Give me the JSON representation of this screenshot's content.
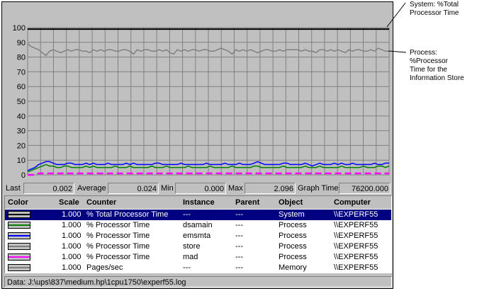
{
  "chart_data": {
    "type": "line",
    "y_ticks": [
      "100",
      "90",
      "80",
      "70",
      "60",
      "50",
      "40",
      "30",
      "20",
      "10",
      "0"
    ],
    "ylim": [
      0,
      100
    ],
    "grid": true,
    "series": [
      {
        "name": "% Total Processor Time",
        "color": "#000000",
        "values": [
          99,
          99,
          99,
          99,
          99,
          99,
          99,
          99,
          99,
          99,
          99,
          99,
          99,
          99,
          99,
          99,
          99,
          99,
          99,
          99,
          99,
          99,
          99,
          99,
          99,
          99,
          99,
          99,
          99,
          99,
          99,
          99,
          99,
          99,
          99,
          99,
          99,
          99,
          99,
          99,
          99,
          99,
          99,
          99,
          99,
          99,
          99,
          99,
          99,
          99,
          99,
          99,
          99,
          99,
          99,
          99,
          99,
          99,
          99,
          99,
          99,
          99,
          99,
          99,
          99,
          99,
          99,
          99,
          99,
          99,
          99,
          99,
          99,
          99,
          99,
          99,
          99,
          99,
          99,
          99,
          99,
          99,
          99,
          99,
          99,
          99,
          99,
          99,
          99,
          99,
          99,
          99,
          99,
          99,
          99,
          99,
          99,
          99,
          99,
          99
        ]
      },
      {
        "name": "% Processor Time (store)",
        "color": "#808080",
        "values": [
          89,
          87,
          86,
          85,
          83,
          81,
          84,
          85,
          84,
          83,
          84,
          85,
          84,
          85,
          85,
          84,
          84,
          83,
          85,
          84,
          85,
          84,
          85,
          85,
          84,
          84,
          85,
          85,
          84,
          82,
          85,
          84,
          85,
          85,
          84,
          84,
          85,
          84,
          85,
          83,
          82,
          85,
          84,
          85,
          84,
          85,
          85,
          84,
          85,
          85,
          84,
          84,
          85,
          86,
          85,
          84,
          82,
          85,
          84,
          85,
          84,
          85,
          84,
          83,
          84,
          85,
          85,
          84,
          84,
          85,
          84,
          85,
          85,
          85,
          85,
          84,
          85,
          84,
          84,
          83,
          85,
          85,
          84,
          85,
          84,
          85,
          84,
          83,
          85,
          84,
          85,
          85,
          84,
          84,
          85,
          84,
          86,
          85,
          84,
          84
        ]
      },
      {
        "name": "% Processor Time (emsmta)",
        "color": "#0000ff",
        "values": [
          3,
          4,
          5,
          7,
          8,
          9,
          9,
          8,
          7,
          7,
          7,
          8,
          8,
          7,
          7,
          7,
          8,
          7,
          8,
          7,
          7,
          7,
          8,
          7,
          7,
          7,
          7,
          8,
          7,
          8,
          7,
          7,
          7,
          7,
          7,
          8,
          8,
          7,
          7,
          7,
          7,
          7,
          8,
          7,
          7,
          7,
          7,
          7,
          7,
          8,
          7,
          7,
          7,
          7,
          8,
          7,
          7,
          7,
          8,
          7,
          7,
          7,
          8,
          9,
          8,
          7,
          7,
          7,
          7,
          7,
          8,
          8,
          7,
          7,
          7,
          7,
          8,
          7,
          6,
          7,
          8,
          7,
          7,
          7,
          8,
          7,
          8,
          7,
          7,
          8,
          7,
          7,
          7,
          7,
          7,
          8,
          7,
          7,
          8,
          8
        ]
      },
      {
        "name": "% Processor Time (dsamain)",
        "color": "#008000",
        "values": [
          2,
          3,
          4,
          5,
          6,
          7,
          6,
          6,
          5,
          5,
          6,
          6,
          5,
          5,
          5,
          5,
          6,
          5,
          6,
          5,
          5,
          5,
          5,
          5,
          6,
          5,
          5,
          5,
          6,
          5,
          5,
          5,
          5,
          5,
          6,
          5,
          5,
          5,
          6,
          5,
          5,
          5,
          5,
          5,
          6,
          5,
          5,
          5,
          5,
          5,
          6,
          5,
          5,
          5,
          5,
          5,
          6,
          5,
          5,
          5,
          5,
          5,
          6,
          6,
          5,
          5,
          5,
          5,
          5,
          5,
          6,
          5,
          5,
          5,
          5,
          5,
          6,
          5,
          5,
          5,
          6,
          5,
          5,
          5,
          5,
          5,
          6,
          5,
          5,
          5,
          5,
          5,
          6,
          5,
          5,
          5,
          6,
          6,
          5,
          6
        ]
      },
      {
        "name": "% Processor Time (mad)",
        "color": "#ff00ff",
        "values": [
          0,
          0,
          0,
          1,
          1,
          1,
          1,
          1,
          1,
          1,
          1,
          1,
          1,
          1,
          1,
          1,
          1,
          1,
          1,
          1,
          1,
          1,
          1,
          1,
          1,
          1,
          1,
          1,
          1,
          1,
          1,
          1,
          1,
          1,
          1,
          1,
          1,
          1,
          1,
          1,
          1,
          1,
          1,
          1,
          1,
          1,
          1,
          1,
          1,
          1,
          1,
          1,
          1,
          1,
          1,
          1,
          1,
          1,
          1,
          1,
          1,
          1,
          1,
          1,
          1,
          1,
          1,
          1,
          1,
          1,
          1,
          1,
          1,
          1,
          1,
          1,
          1,
          1,
          1,
          1,
          1,
          1,
          1,
          1,
          1,
          1,
          1,
          1,
          1,
          1,
          1,
          1,
          1,
          1,
          1,
          1,
          1,
          1,
          1,
          1
        ]
      }
    ]
  },
  "stats": {
    "last_label": "Last",
    "last_value": "0.002",
    "average_label": "Average",
    "average_value": "0.024",
    "min_label": "Min",
    "min_value": "0.000",
    "max_label": "Max",
    "max_value": "2.096",
    "graph_time_label": "Graph Time",
    "graph_time_value": "76200.000"
  },
  "legend": {
    "headers": {
      "color": "Color",
      "scale": "Scale",
      "counter": "Counter",
      "instance": "Instance",
      "parent": "Parent",
      "object": "Object",
      "computer": "Computer"
    },
    "rows": [
      {
        "swatch": "#000000",
        "scale": "1.000",
        "counter": "% Total Processor Time",
        "instance": "---",
        "parent": "---",
        "object": "System",
        "computer": "\\\\EXPERF55"
      },
      {
        "swatch": "#008000",
        "scale": "1.000",
        "counter": "% Processor Time",
        "instance": "dsamain",
        "parent": "---",
        "object": "Process",
        "computer": "\\\\EXPERF55"
      },
      {
        "swatch": "#0000ff",
        "scale": "1.000",
        "counter": "% Processor Time",
        "instance": "emsmta",
        "parent": "---",
        "object": "Process",
        "computer": "\\\\EXPERF55"
      },
      {
        "swatch": "#808080",
        "scale": "1.000",
        "counter": "% Processor Time",
        "instance": "store",
        "parent": "---",
        "object": "Process",
        "computer": "\\\\EXPERF55"
      },
      {
        "swatch": "#ff00ff",
        "scale": "1.000",
        "counter": "% Processor Time",
        "instance": "mad",
        "parent": "---",
        "object": "Process",
        "computer": "\\\\EXPERF55"
      },
      {
        "swatch": "#808080",
        "scale": "1.000",
        "counter": "Pages/sec",
        "instance": "---",
        "parent": "---",
        "object": "Memory",
        "computer": "\\\\EXPERF55"
      }
    ]
  },
  "status_bar": "Data: J:\\ups\\837\\medium.hp\\1cpu1750\\experf55.log",
  "annotations": {
    "system_line1": "System: %Total",
    "system_line2": "Processor Time",
    "process_line1": "Process: %Processor",
    "process_line2": "Time for the",
    "process_line3": "Information Store"
  }
}
